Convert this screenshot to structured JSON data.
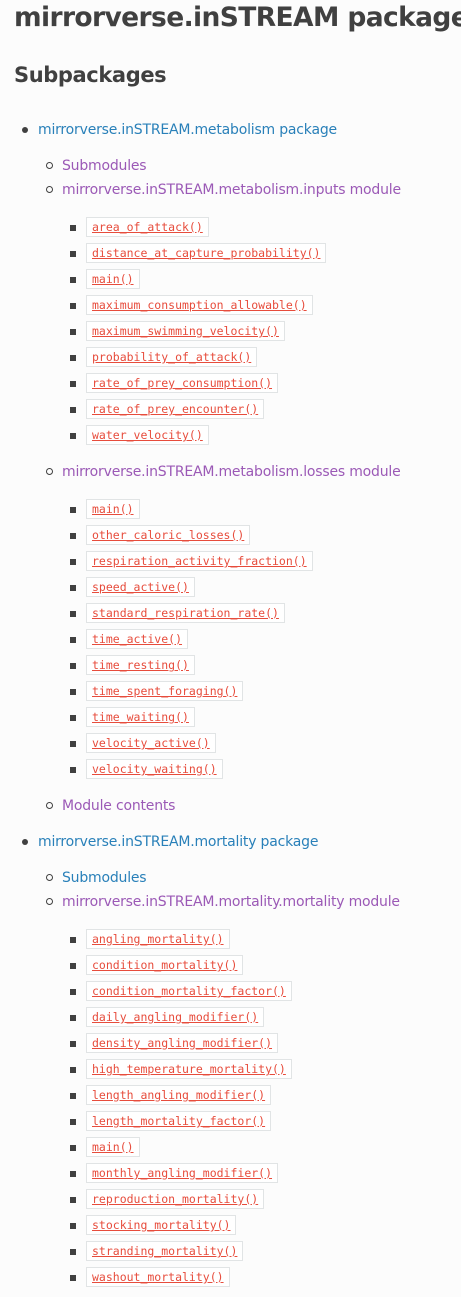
{
  "page": {
    "title": "mirrorverse.inSTREAM package",
    "section_title": "Subpackages"
  },
  "toc": {
    "metabolism_package": "mirrorverse.inSTREAM.metabolism package",
    "metabolism_submodules": "Submodules",
    "metabolism_inputs_module": "mirrorverse.inSTREAM.metabolism.inputs module",
    "inputs_functions": [
      "area_of_attack()",
      "distance_at_capture_probability()",
      "main()",
      "maximum_consumption_allowable()",
      "maximum_swimming_velocity()",
      "probability_of_attack()",
      "rate_of_prey_consumption()",
      "rate_of_prey_encounter()",
      "water_velocity()"
    ],
    "metabolism_losses_module": "mirrorverse.inSTREAM.metabolism.losses module",
    "losses_functions": [
      "main()",
      "other_caloric_losses()",
      "respiration_activity_fraction()",
      "speed_active()",
      "standard_respiration_rate()",
      "time_active()",
      "time_resting()",
      "time_spent_foraging()",
      "time_waiting()",
      "velocity_active()",
      "velocity_waiting()"
    ],
    "metabolism_module_contents": "Module contents",
    "mortality_package": "mirrorverse.inSTREAM.mortality package",
    "mortality_submodules": "Submodules",
    "mortality_mortality_module": "mirrorverse.inSTREAM.mortality.mortality module",
    "mortality_functions": [
      "angling_mortality()",
      "condition_mortality()",
      "condition_mortality_factor()",
      "daily_angling_modifier()",
      "density_angling_modifier()",
      "high_temperature_mortality()",
      "length_angling_modifier()",
      "length_mortality_factor()",
      "main()",
      "monthly_angling_modifier()",
      "reproduction_mortality()",
      "stocking_mortality()",
      "stranding_mortality()",
      "washout_mortality()"
    ]
  },
  "colors": {
    "text": "#404040",
    "link_package": "#2980b9",
    "link_visited": "#9b59b6",
    "code_text": "#e74c3c",
    "code_border": "#e1e4e5",
    "background": "#fcfcfc"
  }
}
